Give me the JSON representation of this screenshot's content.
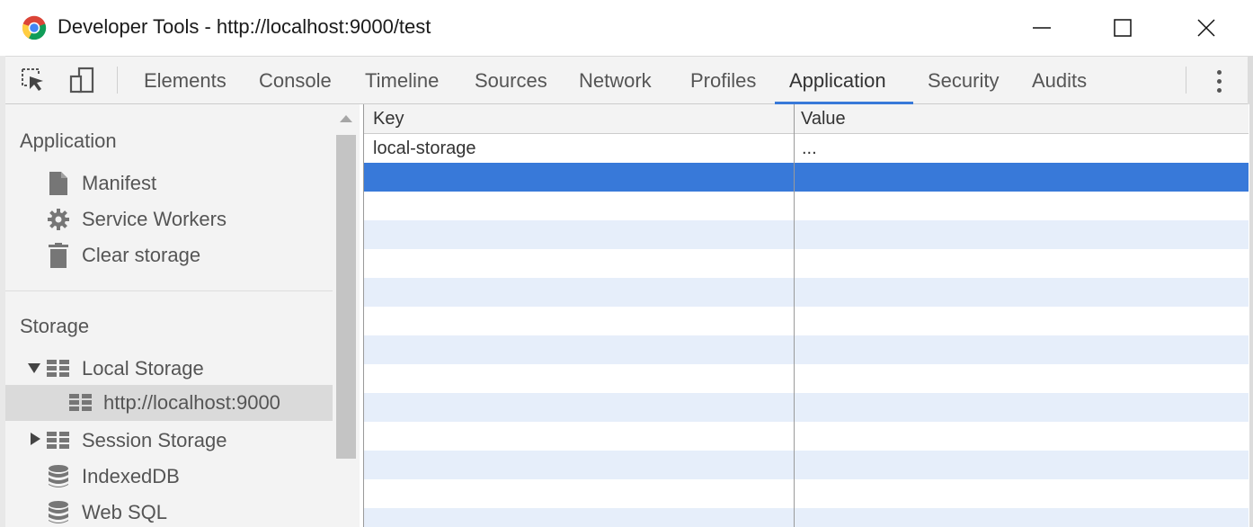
{
  "window": {
    "title": "Developer Tools - http://localhost:9000/test"
  },
  "toolbar": {
    "tabs": [
      {
        "label": "Elements"
      },
      {
        "label": "Console"
      },
      {
        "label": "Timeline"
      },
      {
        "label": "Sources"
      },
      {
        "label": "Network"
      },
      {
        "label": "Profiles"
      },
      {
        "label": "Application",
        "active": true
      },
      {
        "label": "Security"
      },
      {
        "label": "Audits"
      }
    ]
  },
  "sidebar": {
    "application_heading": "Application",
    "application_items": [
      {
        "label": "Manifest",
        "icon": "document-icon"
      },
      {
        "label": "Service Workers",
        "icon": "gear-icon"
      },
      {
        "label": "Clear storage",
        "icon": "trash-icon"
      }
    ],
    "storage_heading": "Storage",
    "storage_items": [
      {
        "label": "Local Storage",
        "icon": "grid-icon",
        "expanded": true
      },
      {
        "label": "http://localhost:9000",
        "icon": "grid-icon",
        "selected": true
      },
      {
        "label": "Session Storage",
        "icon": "grid-icon",
        "expanded": false
      },
      {
        "label": "IndexedDB",
        "icon": "database-icon"
      },
      {
        "label": "Web SQL",
        "icon": "database-icon"
      }
    ]
  },
  "table": {
    "columns": {
      "key": "Key",
      "value": "Value"
    },
    "rows": [
      {
        "key": "local-storage",
        "value": "..."
      }
    ]
  },
  "colors": {
    "accent": "#3879d9",
    "selected_row": "#3879d9",
    "alt_row": "#e6eefa",
    "panel_bg": "#f3f3f3"
  }
}
